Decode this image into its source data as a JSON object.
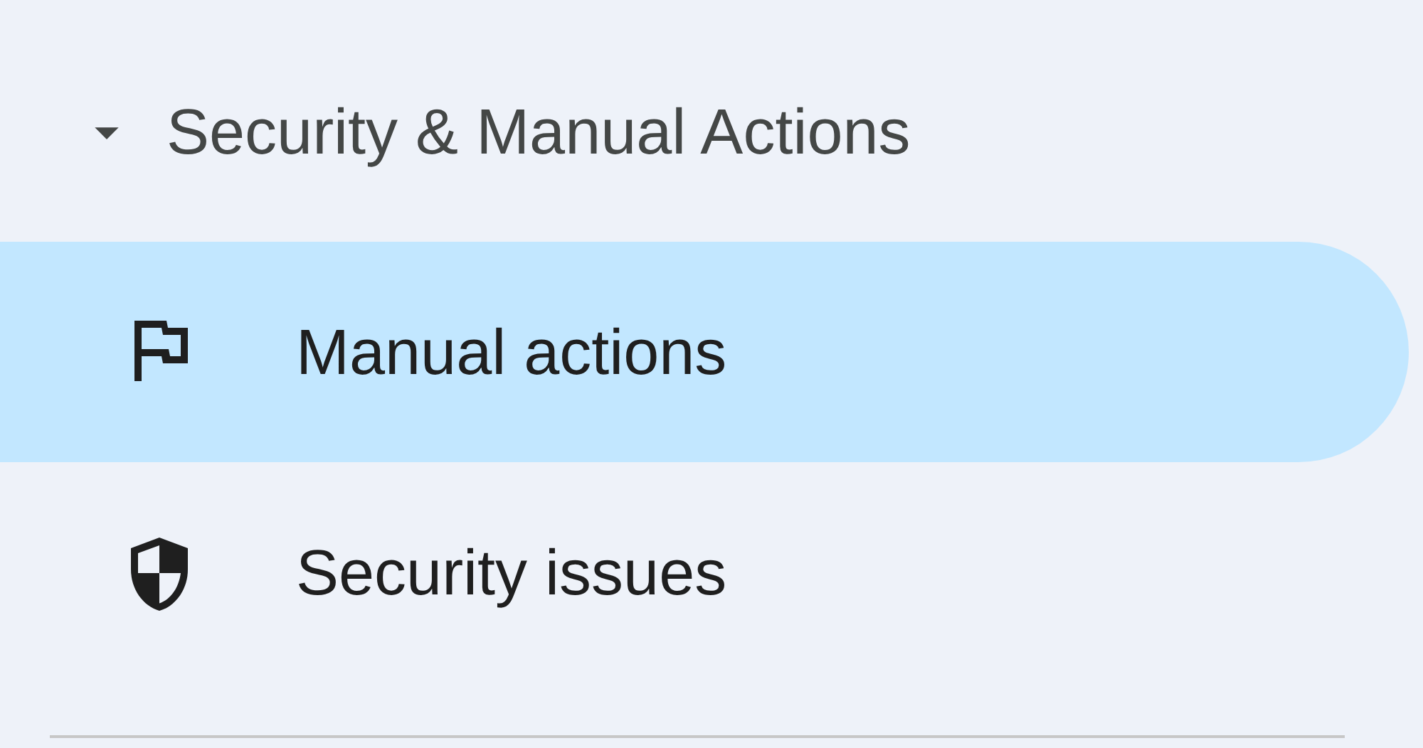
{
  "section": {
    "title": "Security & Manual Actions",
    "expanded": true
  },
  "items": [
    {
      "label": "Manual actions",
      "kind": "flag",
      "selected": true
    },
    {
      "label": "Security issues",
      "kind": "shield",
      "selected": false
    }
  ]
}
